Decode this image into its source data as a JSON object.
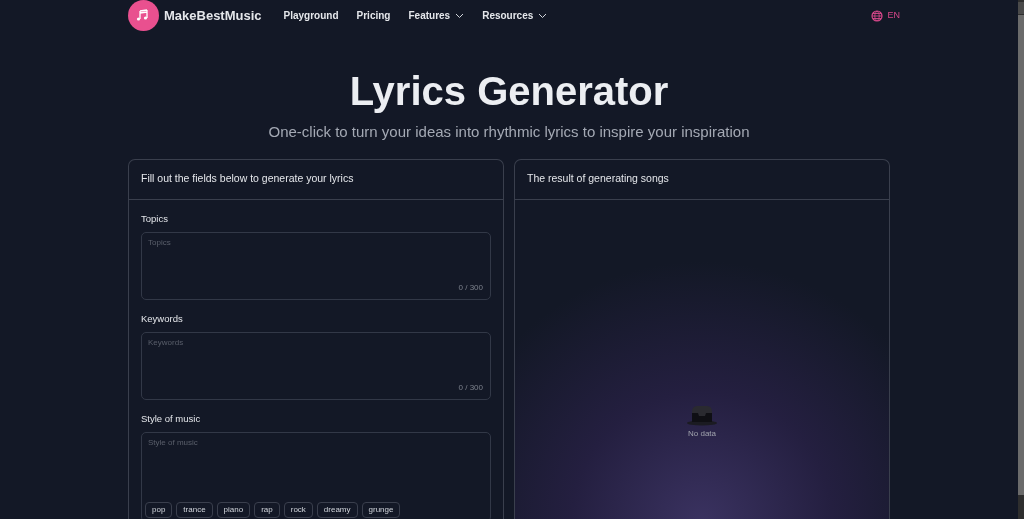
{
  "nav": {
    "brand": "MakeBestMusic",
    "links": [
      {
        "label": "Playground",
        "dropdown": false
      },
      {
        "label": "Pricing",
        "dropdown": false
      },
      {
        "label": "Features",
        "dropdown": true
      },
      {
        "label": "Resources",
        "dropdown": true
      }
    ],
    "language": "EN"
  },
  "hero": {
    "title": "Lyrics Generator",
    "subtitle": "One-click to turn your ideas into rhythmic lyrics to inspire your inspiration"
  },
  "form_card": {
    "title": "Fill out the fields below to generate your lyrics",
    "fields": [
      {
        "label": "Topics",
        "placeholder": "Topics",
        "counter": "0 / 300"
      },
      {
        "label": "Keywords",
        "placeholder": "Keywords",
        "counter": "0 / 300"
      },
      {
        "label": "Style of music",
        "placeholder": "Style of music",
        "tags": [
          "pop",
          "trance",
          "piano",
          "rap",
          "rock",
          "dreamy",
          "grunge"
        ]
      }
    ]
  },
  "result_card": {
    "title": "The result of generating songs",
    "empty_text": "No data"
  }
}
